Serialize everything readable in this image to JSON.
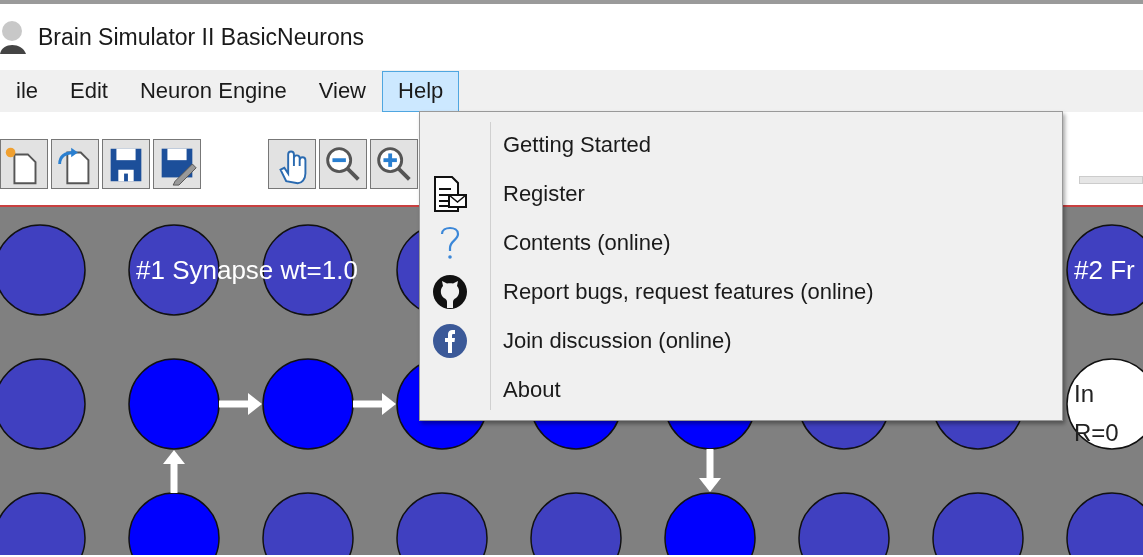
{
  "window": {
    "title": "Brain Simulator II BasicNeurons"
  },
  "menu_bar": [
    {
      "label": "ile",
      "selected": false
    },
    {
      "label": "Edit",
      "selected": false
    },
    {
      "label": "Neuron Engine",
      "selected": false
    },
    {
      "label": "View",
      "selected": false
    },
    {
      "label": "Help",
      "selected": true
    }
  ],
  "help_menu": {
    "items": [
      "Getting Started",
      "Register",
      "Contents (online)",
      "Report bugs, request features (online)",
      "Join discussion (online)",
      "About"
    ]
  },
  "network": {
    "neurons": [
      [
        {
          "kind": "neuron",
          "firing": false
        },
        {
          "kind": "neuron",
          "firing": false,
          "label": "#1 Synapse wt=1.0"
        },
        {
          "kind": "neuron",
          "firing": false
        },
        {
          "kind": "neuron",
          "firing": false
        },
        {
          "kind": "hidden"
        },
        {
          "kind": "hidden"
        },
        {
          "kind": "hidden"
        },
        {
          "kind": "hidden"
        },
        {
          "kind": "neuron",
          "firing": false,
          "label": "#2 Fr"
        }
      ],
      [
        {
          "kind": "neuron",
          "firing": false
        },
        {
          "kind": "neuron",
          "firing": true
        },
        {
          "kind": "neuron",
          "firing": true
        },
        {
          "kind": "neuron",
          "firing": true
        },
        {
          "kind": "neuron",
          "firing": true
        },
        {
          "kind": "neuron",
          "firing": true
        },
        {
          "kind": "neuron",
          "firing": false
        },
        {
          "kind": "neuron",
          "firing": false
        },
        {
          "kind": "input",
          "lines": [
            "In",
            "R=0"
          ]
        }
      ],
      [
        {
          "kind": "neuron",
          "firing": false
        },
        {
          "kind": "neuron",
          "firing": true
        },
        {
          "kind": "neuron",
          "firing": false
        },
        {
          "kind": "neuron",
          "firing": false
        },
        {
          "kind": "neuron",
          "firing": false
        },
        {
          "kind": "neuron",
          "firing": true
        },
        {
          "kind": "neuron",
          "firing": false
        },
        {
          "kind": "neuron",
          "firing": false
        },
        {
          "kind": "neuron",
          "firing": false
        }
      ]
    ]
  }
}
